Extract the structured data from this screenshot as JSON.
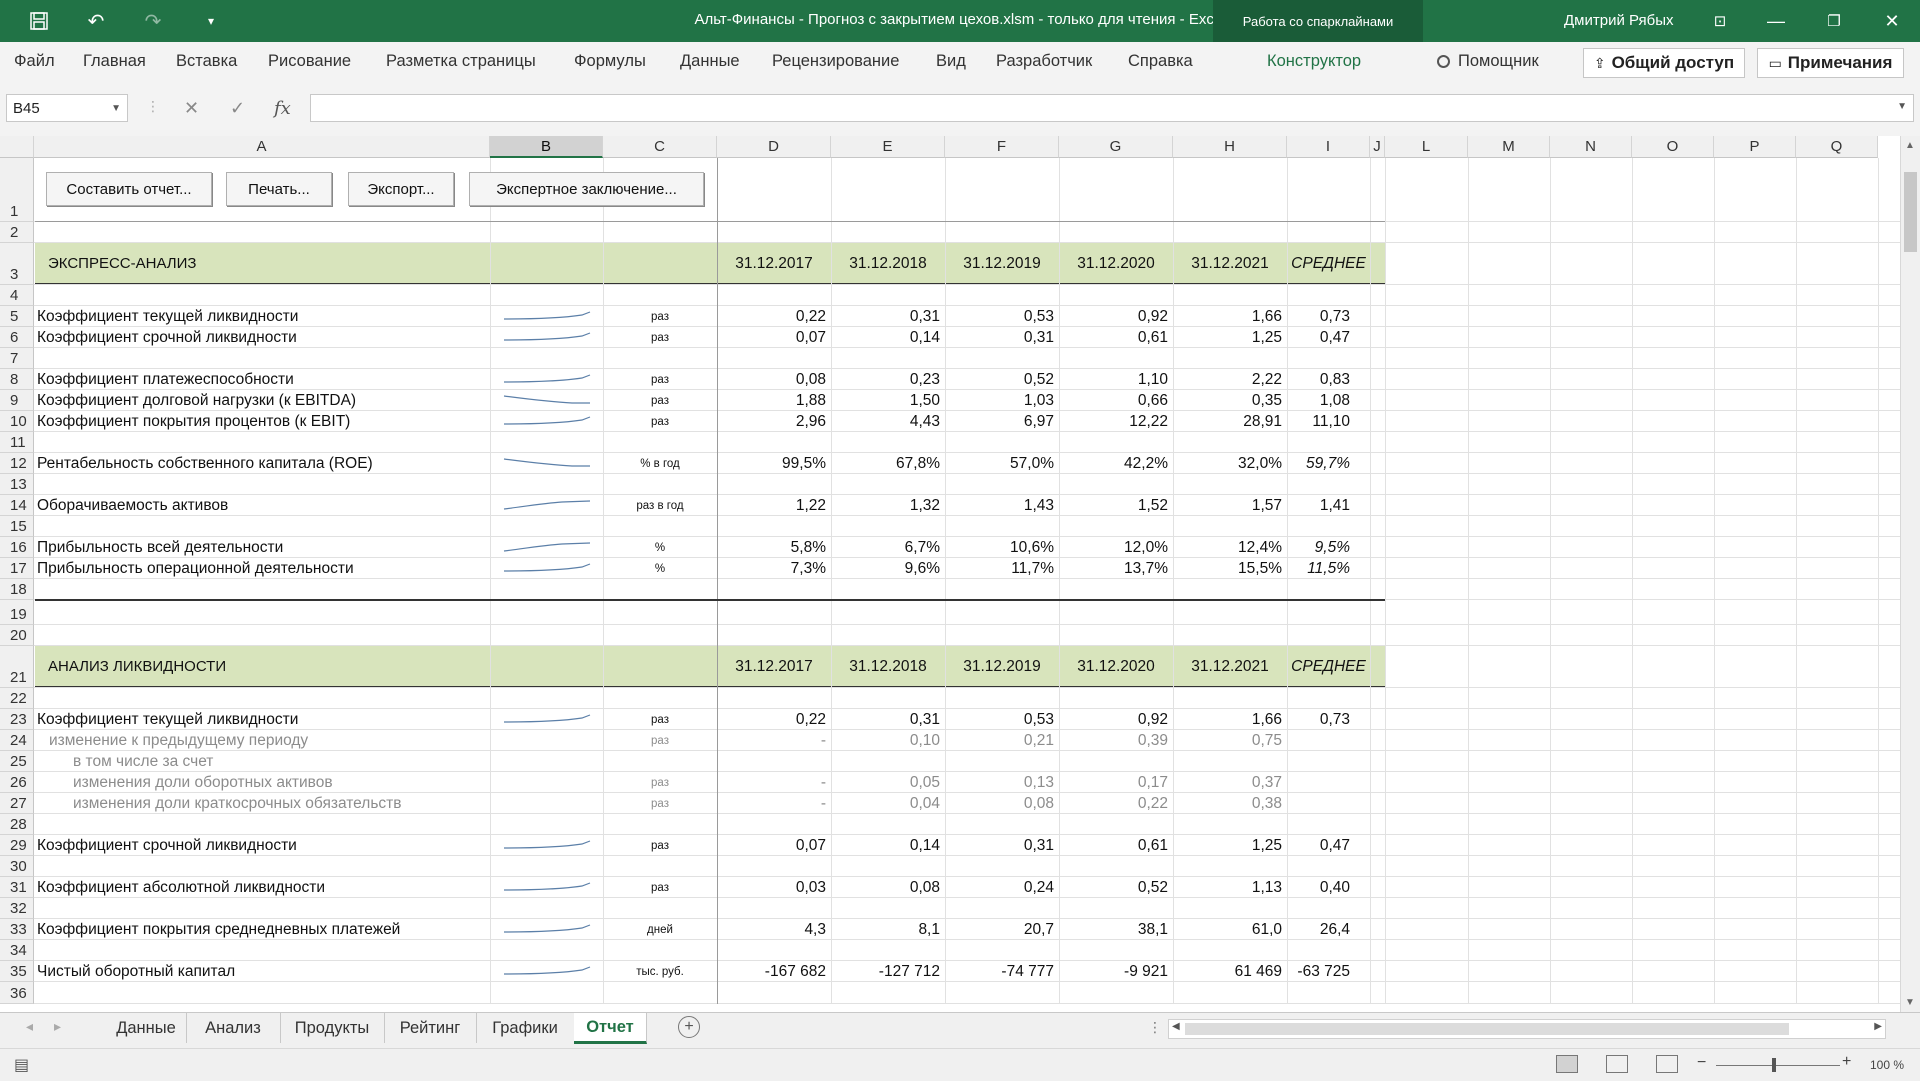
{
  "window": {
    "title": "Альт-Финансы - Прогноз с закрытием цехов.xlsm  -  только для чтения  -  Excel",
    "context_tab": "Работа со спарклайнами",
    "user": "Дмитрий Рябых"
  },
  "menu": {
    "items": [
      "Файл",
      "Главная",
      "Вставка",
      "Рисование",
      "Разметка страницы",
      "Формулы",
      "Данные",
      "Рецензирование",
      "Вид",
      "Разработчик",
      "Справка",
      "Конструктор"
    ],
    "helper": "Помощник",
    "share": "Общий доступ",
    "notes": "Примечания"
  },
  "formula": {
    "namebox": "B45",
    "fx": "fx",
    "value": ""
  },
  "columns": [
    "A",
    "B",
    "C",
    "D",
    "E",
    "F",
    "G",
    "H",
    "I",
    "J",
    "L",
    "M",
    "N",
    "O",
    "P",
    "Q"
  ],
  "selected_column": "B",
  "rows": [
    "1",
    "2",
    "3",
    "4",
    "5",
    "6",
    "7",
    "8",
    "9",
    "10",
    "11",
    "12",
    "13",
    "14",
    "15",
    "16",
    "17",
    "18",
    "19",
    "20",
    "21",
    "22",
    "23",
    "24",
    "25",
    "26",
    "27",
    "28",
    "29",
    "30",
    "31",
    "32",
    "33",
    "34",
    "35",
    "36"
  ],
  "buttons": {
    "report": "Составить отчет...",
    "print": "Печать...",
    "export": "Экспорт...",
    "expert": "Экспертное заключение..."
  },
  "section1": {
    "title": "ЭКСПРЕСС-АНАЛИЗ",
    "dates": [
      "31.12.2017",
      "31.12.2018",
      "31.12.2019",
      "31.12.2020",
      "31.12.2021"
    ],
    "avg": "СРЕДНЕЕ",
    "rows": [
      {
        "name": "Коэффициент текущей ликвидности",
        "unit": "раз",
        "v": [
          "0,22",
          "0,31",
          "0,53",
          "0,92",
          "1,66"
        ],
        "avg": "0,73",
        "spark": "up"
      },
      {
        "name": "Коэффициент срочной ликвидности",
        "unit": "раз",
        "v": [
          "0,07",
          "0,14",
          "0,31",
          "0,61",
          "1,25"
        ],
        "avg": "0,47",
        "spark": "up"
      },
      {
        "name": "Коэффициент платежеспособности",
        "unit": "раз",
        "v": [
          "0,08",
          "0,23",
          "0,52",
          "1,10",
          "2,22"
        ],
        "avg": "0,83",
        "spark": "up"
      },
      {
        "name": "Коэффициент долговой нагрузки (к EBITDA)",
        "unit": "раз",
        "v": [
          "1,88",
          "1,50",
          "1,03",
          "0,66",
          "0,35"
        ],
        "avg": "1,08",
        "spark": "down"
      },
      {
        "name": "Коэффициент покрытия процентов (к EBIT)",
        "unit": "раз",
        "v": [
          "2,96",
          "4,43",
          "6,97",
          "12,22",
          "28,91"
        ],
        "avg": "11,10",
        "spark": "up"
      },
      {
        "name": "Рентабельность собственного капитала (ROE)",
        "unit": "% в год",
        "v": [
          "99,5%",
          "67,8%",
          "57,0%",
          "42,2%",
          "32,0%"
        ],
        "avg": "59,7%",
        "spark": "down",
        "italic": true
      },
      {
        "name": "Оборачиваемость активов",
        "unit": "раз в год",
        "v": [
          "1,22",
          "1,32",
          "1,43",
          "1,52",
          "1,57"
        ],
        "avg": "1,41",
        "spark": "up2"
      },
      {
        "name": "Прибыльность всей деятельности",
        "unit": "%",
        "v": [
          "5,8%",
          "6,7%",
          "10,6%",
          "12,0%",
          "12,4%"
        ],
        "avg": "9,5%",
        "spark": "up2",
        "italic": true
      },
      {
        "name": "Прибыльность операционной деятельности",
        "unit": "%",
        "v": [
          "7,3%",
          "9,6%",
          "11,7%",
          "13,7%",
          "15,5%"
        ],
        "avg": "11,5%",
        "spark": "up",
        "italic": true
      }
    ]
  },
  "section2": {
    "title": "АНАЛИЗ ЛИКВИДНОСТИ",
    "dates": [
      "31.12.2017",
      "31.12.2018",
      "31.12.2019",
      "31.12.2020",
      "31.12.2021"
    ],
    "avg": "СРЕДНЕЕ",
    "rows": [
      {
        "name": "Коэффициент текущей ликвидности",
        "unit": "раз",
        "v": [
          "0,22",
          "0,31",
          "0,53",
          "0,92",
          "1,66"
        ],
        "avg": "0,73",
        "spark": "up"
      },
      {
        "name": "изменение к предыдущему периоду",
        "unit": "раз",
        "v": [
          "-",
          "0,10",
          "0,21",
          "0,39",
          "0,75"
        ],
        "avg": "",
        "gray": true
      },
      {
        "name": "в том числе за счет",
        "unit": "",
        "v": [
          "",
          "",
          "",
          "",
          ""
        ],
        "avg": "",
        "gray": true
      },
      {
        "name": "изменения доли оборотных активов",
        "unit": "раз",
        "v": [
          "-",
          "0,05",
          "0,13",
          "0,17",
          "0,37"
        ],
        "avg": "",
        "gray": true
      },
      {
        "name": "изменения доли краткосрочных обязательств",
        "unit": "раз",
        "v": [
          "-",
          "0,04",
          "0,08",
          "0,22",
          "0,38"
        ],
        "avg": "",
        "gray": true
      },
      {
        "name": "Коэффициент срочной ликвидности",
        "unit": "раз",
        "v": [
          "0,07",
          "0,14",
          "0,31",
          "0,61",
          "1,25"
        ],
        "avg": "0,47",
        "spark": "up"
      },
      {
        "name": "Коэффициент абсолютной ликвидности",
        "unit": "раз",
        "v": [
          "0,03",
          "0,08",
          "0,24",
          "0,52",
          "1,13"
        ],
        "avg": "0,40",
        "spark": "up"
      },
      {
        "name": "Коэффициент покрытия среднедневных платежей",
        "unit": "дней",
        "v": [
          "4,3",
          "8,1",
          "20,7",
          "38,1",
          "61,0"
        ],
        "avg": "26,4",
        "spark": "up"
      },
      {
        "name": "Чистый оборотный капитал",
        "unit": "тыс. руб.",
        "v": [
          "-167 682",
          "-127 712",
          "-74 777",
          "-9 921",
          "61 469"
        ],
        "avg": "-63 725",
        "spark": "up"
      }
    ]
  },
  "tabs": [
    "Данные",
    "Анализ",
    "Продукты",
    "Рейтинг",
    "Графики",
    "Отчет"
  ],
  "active_tab": "Отчет",
  "status": {
    "zoom": "100 %"
  },
  "colors": {
    "accent": "#217346",
    "band": "#d8e4bc"
  }
}
